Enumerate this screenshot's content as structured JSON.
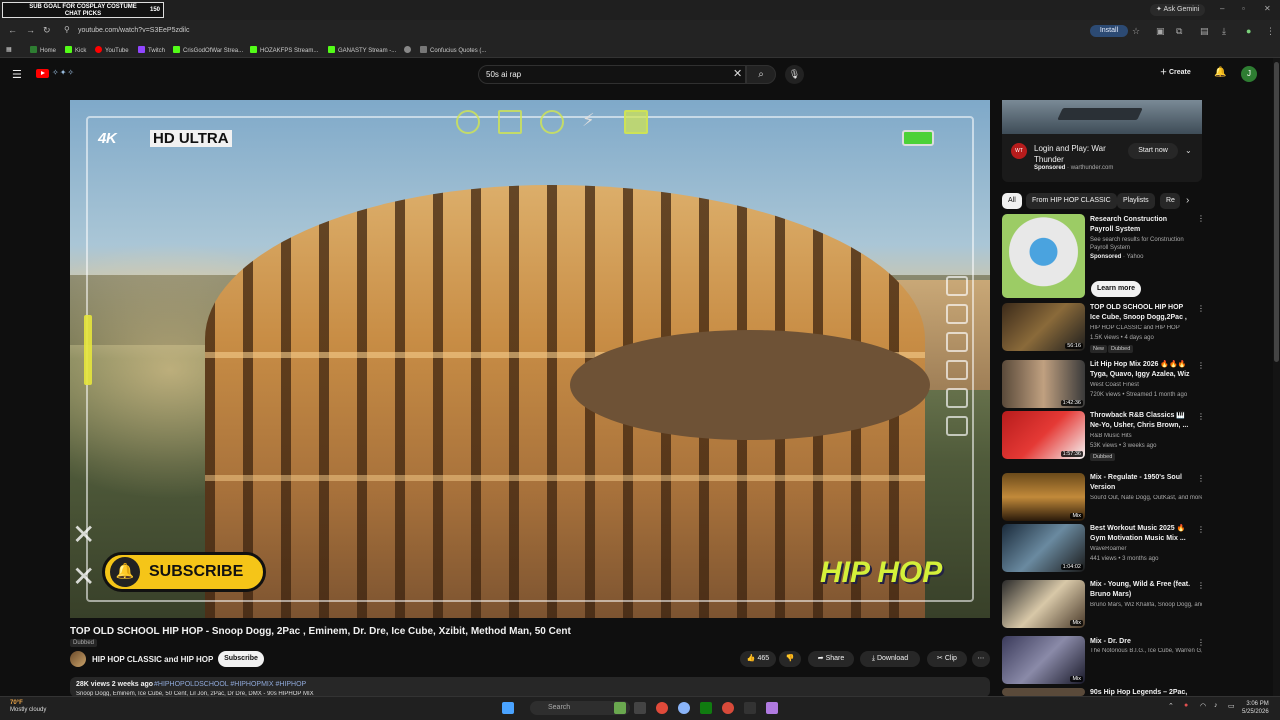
{
  "overlay": {
    "line1": "SUB GOAL FOR COSPLAY COSTUME",
    "line2": "CHAT PICKS",
    "count": "150"
  },
  "browser": {
    "ask_gemini": "Ask Gemini",
    "url": "youtube.com/watch?v=S3EeP5zdilc",
    "install": "Install",
    "bookmarks": [
      {
        "label": "Home",
        "color": "#2e7d32"
      },
      {
        "label": "Kick",
        "color": "#53fc18"
      },
      {
        "label": "YouTube",
        "color": "#ff0000"
      },
      {
        "label": "Twitch",
        "color": "#9146ff"
      },
      {
        "label": "CrisGodOfWar Strea...",
        "color": "#53fc18"
      },
      {
        "label": "HOZAKFPS Stream...",
        "color": "#53fc18"
      },
      {
        "label": "GANASTY Stream -...",
        "color": "#53fc18"
      },
      {
        "label": "",
        "color": "#888888"
      },
      {
        "label": "Confucius Quotes (...",
        "color": "#777777"
      }
    ]
  },
  "youtube": {
    "search_query": "50s ai rap",
    "create_label": "Create",
    "avatar_letter": "J"
  },
  "video": {
    "hud_label": "HD ULTRA",
    "subscribe_overlay": "SUBSCRIBE",
    "hiphop_overlay": "HIP HOP",
    "title": "TOP OLD SCHOOL HIP HOP - Snoop Dogg, 2Pac , Eminem, Dr. Dre, Ice Cube, Xzibit, Method Man, 50 Cent",
    "dubbed": "Dubbed",
    "channel": "HIP HOP CLASSIC and HIP HOP",
    "subscribe_label": "Subscribe",
    "likes": "465",
    "share_label": "Share",
    "download_label": "Download",
    "clip_label": "Clip",
    "views_age": "28K views  2 weeks ago",
    "tags": "#HIPHOPOLDSCHOOL #HIPHOPMIX #HIPHOP",
    "desc_line": "Snoop Dogg, Eminem, Ice Cube, 50 Cent, Lil Jon, 2Pac, Dr Dre, DMX - 90s HIPHOP MIX"
  },
  "ad": {
    "title": "Login and Play: War Thunder",
    "sponsored": "Sponsored",
    "domain": "warthunder.com",
    "cta": "Start now"
  },
  "chips": [
    "All",
    "From HIP HOP CLASSIC",
    "Playlists",
    "Re"
  ],
  "recs": [
    {
      "title": "Research Construction Payroll System",
      "channel": "See search results for Construction Payroll System",
      "meta": "Yahoo",
      "sponsored": "Sponsored",
      "cta": "Learn more"
    },
    {
      "title": "TOP OLD SCHOOL HIP HOP Ice Cube, Snoop Dogg,2Pac , ...",
      "channel": "HIP HOP CLASSIC and HIP HOP",
      "meta": "1.5K views  •  4 days ago",
      "badge": "New",
      "badge2": "Dubbed",
      "duration": "56:16"
    },
    {
      "title": "Lit Hip Hop Mix 2026 🔥🔥🔥 Tyga, Quavo, Iggy Azalea, Wiz ...",
      "channel": "West Coast Finest",
      "meta": "720K views  •  Streamed 1 month ago",
      "duration": "1:42:36"
    },
    {
      "title": "Throwback R&B Classics 🎹 Ne-Yo, Usher, Chris Brown, ...",
      "channel": "R&B Music Hits",
      "meta": "53K views  •  3 weeks ago",
      "badge": "Dubbed",
      "duration": "1:57:36"
    },
    {
      "title": "Mix - Regulate - 1950's Soul Version",
      "channel": "Soul'd Out, Nate Dogg, OutKast, and more",
      "meta": "",
      "duration": "Mix"
    },
    {
      "title": "Best Workout Music 2025 🔥 Gym Motivation Music Mix ...",
      "channel": "WaveRoamer",
      "meta": "441 views  •  3 months ago",
      "duration": "1:04:02"
    },
    {
      "title": "Mix - Young, Wild & Free (feat. Bruno Mars)",
      "channel": "Bruno Mars, Wiz Khalifa, Snoop Dogg, and more",
      "meta": "",
      "duration": "Mix"
    },
    {
      "title": "Mix - Dr. Dre",
      "channel": "The Notorious B.I.G., Ice Cube, Warren G, ...",
      "meta": "",
      "duration": "Mix"
    },
    {
      "title": "90s Hip Hop Legends – 2Pac, ...",
      "channel": "",
      "meta": ""
    }
  ],
  "taskbar": {
    "temp": "70°F",
    "weather": "Mostly cloudy",
    "search_placeholder": "Search",
    "time": "3:06 PM",
    "date": "5/25/2026"
  }
}
